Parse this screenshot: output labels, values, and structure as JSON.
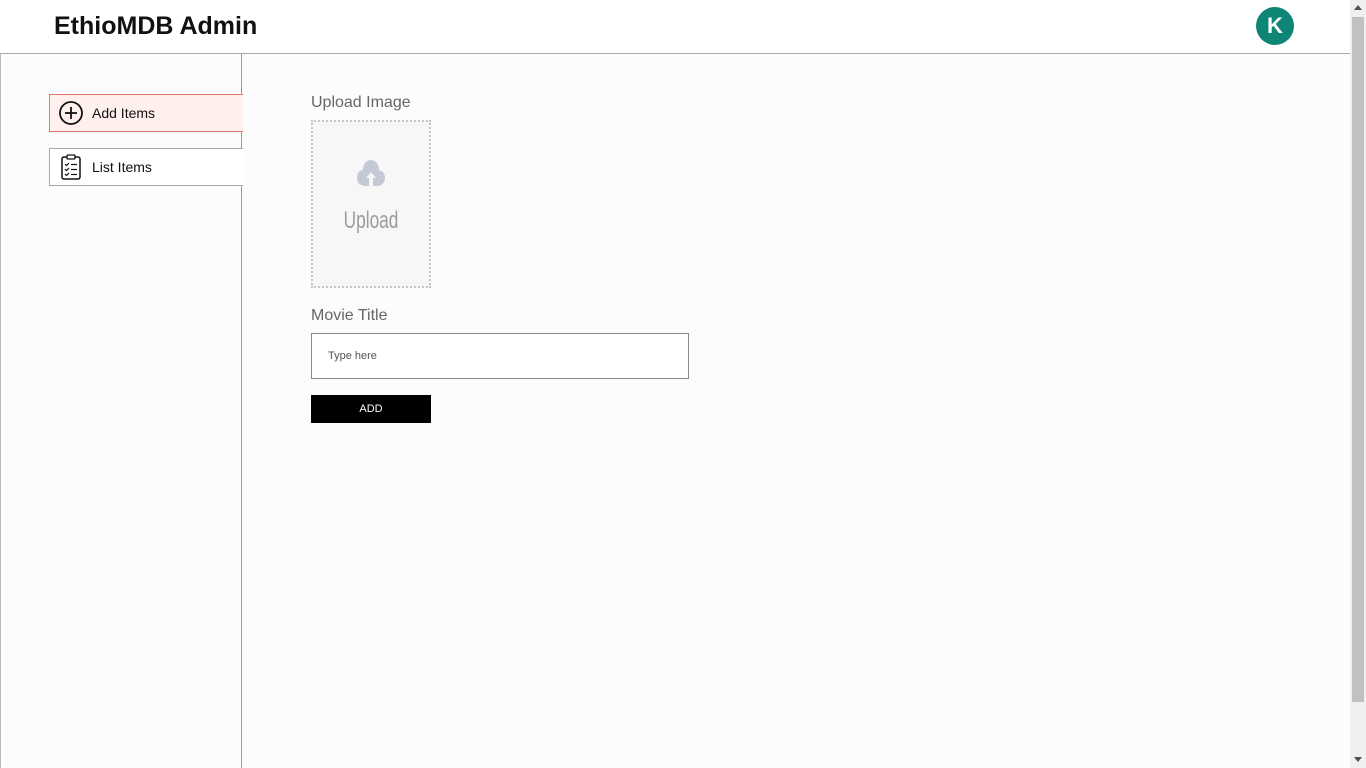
{
  "header": {
    "title": "EthioMDB Admin",
    "avatar_initial": "K",
    "avatar_color": "#0e8575"
  },
  "sidebar": {
    "items": [
      {
        "label": "Add Items",
        "icon": "add-circle-icon",
        "active": true
      },
      {
        "label": "List Items",
        "icon": "clipboard-checklist-icon",
        "active": false
      }
    ]
  },
  "form": {
    "upload_label": "Upload Image",
    "upload_placeholder_text": "Upload",
    "title_label": "Movie Title",
    "title_value": "",
    "title_placeholder": "Type here",
    "submit_label": "ADD"
  },
  "colors": {
    "active_item_background": "#fff0ed",
    "active_item_border": "#e07a6a",
    "button_background": "#000000"
  }
}
